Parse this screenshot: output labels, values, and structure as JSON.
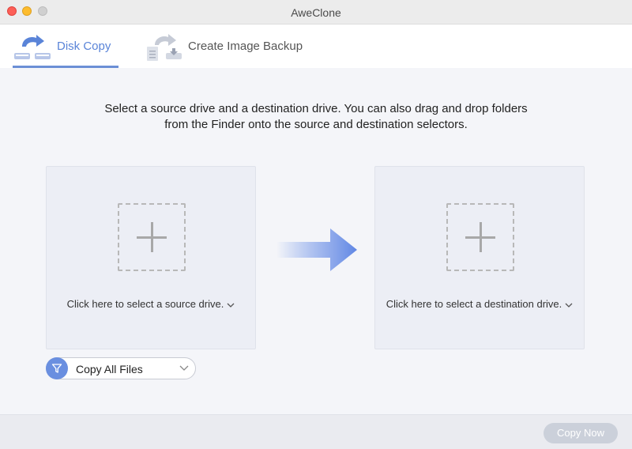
{
  "window": {
    "title": "AweClone"
  },
  "tabs": [
    {
      "label": "Disk Copy",
      "icon": "disk-copy-icon",
      "active": true
    },
    {
      "label": "Create Image Backup",
      "icon": "image-backup-icon",
      "active": false
    }
  ],
  "instructions": {
    "line1": "Select a source drive and a destination drive. You can also drag and drop folders",
    "line2": "from the Finder onto the source and destination selectors."
  },
  "source": {
    "prompt": "Click here to select a source drive."
  },
  "destination": {
    "prompt": "Click here to select a destination drive."
  },
  "filter": {
    "selected": "Copy All Files",
    "icon": "filter-icon"
  },
  "footer": {
    "copy_now_label": "Copy Now"
  },
  "colors": {
    "accent": "#5a84d8",
    "arrow": "#6f93e8",
    "button_disabled": "#cbd0da"
  }
}
